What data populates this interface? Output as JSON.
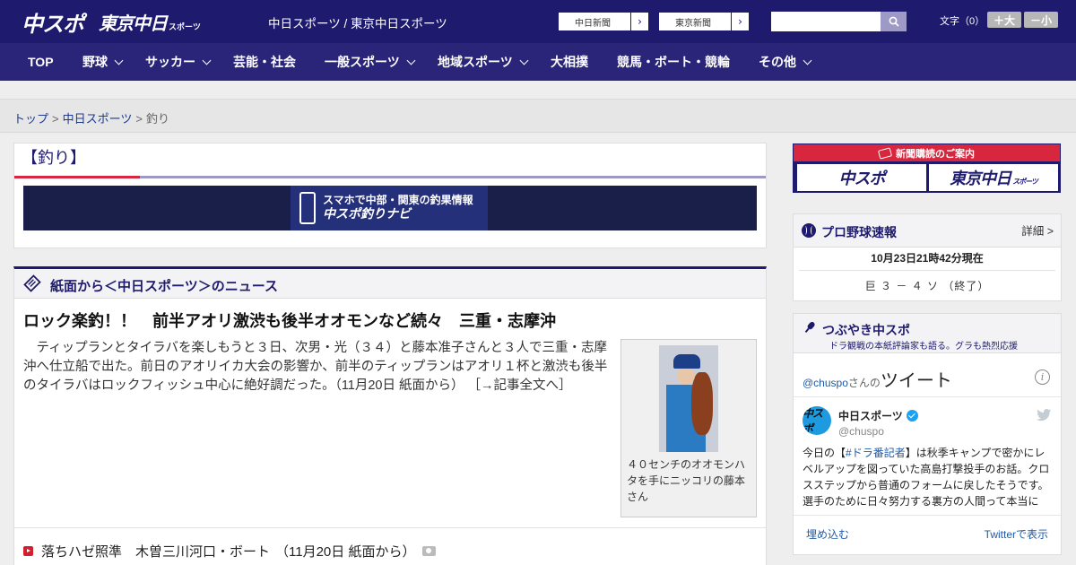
{
  "header": {
    "logo_chuspo": "中スポ",
    "logo_tokyo": "東京中日",
    "logo_tokyo_suffix": "スポーツ",
    "site_title": "中日スポーツ / 東京中日スポーツ",
    "newspaper_links": [
      {
        "label": "中日新聞",
        "arrow": "›"
      },
      {
        "label": "東京新聞",
        "arrow": "›"
      }
    ],
    "search": {
      "value": "",
      "placeholder": ""
    },
    "font_size_label": "文字（0）",
    "font_bigger": "＋大",
    "font_smaller": "－小"
  },
  "nav": {
    "items": [
      {
        "label": "TOP",
        "dropdown": false
      },
      {
        "label": "野球",
        "dropdown": true
      },
      {
        "label": "サッカー",
        "dropdown": true
      },
      {
        "label": "芸能・社会",
        "dropdown": false
      },
      {
        "label": "一般スポーツ",
        "dropdown": true
      },
      {
        "label": "地域スポーツ",
        "dropdown": true
      },
      {
        "label": "大相撲",
        "dropdown": false
      },
      {
        "label": "競馬・ボート・競輪",
        "dropdown": false
      },
      {
        "label": "その他",
        "dropdown": true
      }
    ]
  },
  "breadcrumb": {
    "items": [
      "トップ",
      "中日スポーツ",
      "釣り"
    ],
    "separator": ">"
  },
  "section": {
    "title": "【釣り】",
    "promo_line1": "スマホで中部・関東の釣果情報",
    "promo_line2": "中スポ釣りナビ"
  },
  "news": {
    "heading": "紙面から＜中日スポーツ＞のニュース",
    "headline": "ロック楽釣！！　前半アオリ激渋も後半オオモンなど続々　三重・志摩沖",
    "lead": "　ティップランとタイラバを楽しもうと３日、次男・光（３４）と藤本准子さんと３人で三重・志摩沖へ仕立船で出た。前日のアオリイカ大会の影響か、前半のティップランはアオリ１杯と激渋も後半のタイラバはロックフィッシュ中心に絶好調だった。（11月20日 紙面から）",
    "read_more": "［→記事全文へ］",
    "photo_caption": "４０センチのオオモンハタを手にニッコリの藤本さん",
    "sub_items": [
      {
        "title": "落ちハゼ照準　木曽三川河口・ボート",
        "date": "（11月20日 紙面から）"
      }
    ]
  },
  "sidebar": {
    "subscribe": {
      "label": "新聞購読のご案内",
      "logo1": "中スポ",
      "logo2": "東京中日",
      "logo2_suffix": "スポーツ"
    },
    "baseball": {
      "title": "プロ野球速報",
      "detail": "詳細 >",
      "time": "10月23日21時42分現在",
      "score": "巨 ３ － ４ ソ （終了）"
    },
    "tweets": {
      "title": "つぶやき中スポ",
      "subtitle": "ドラ観戦の本紙評論家も語る。グラも熱烈応援",
      "widget_handle": "@chuspo",
      "widget_san": "さんの",
      "widget_big": "ツイート",
      "info": "i",
      "avatar_text": "中スポ",
      "name": "中日スポーツ",
      "handle": "@chuspo",
      "text_before": "今日の【",
      "text_tag": "#ドラ番記者",
      "text_after": "】は秋季キャンプで密かにレベルアップを図っていた高島打撃投手のお話。クロスステップから普通のフォームに戻したそうです。選手のために日々努力する裏方の人間って本当に",
      "embed": "埋め込む",
      "view_on": "Twitterで表示"
    }
  },
  "colors": {
    "header_bg": "#1e1a6e",
    "nav_bg": "#2a2578",
    "accent_red": "#d7263d",
    "link": "#1e3a8a"
  }
}
